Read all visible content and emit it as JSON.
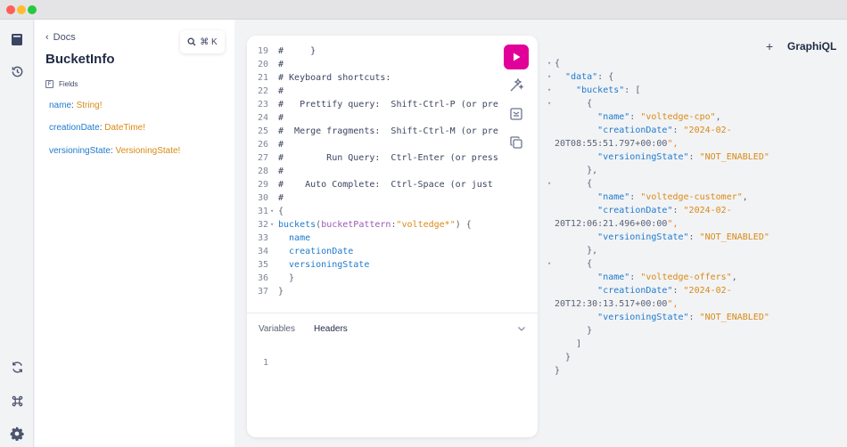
{
  "window": {
    "colors": {
      "red": "#fe5f57",
      "yellow": "#febc2e",
      "green": "#28c840"
    }
  },
  "sidebar_icons": [
    "docs-icon",
    "history-icon",
    "refetch-icon",
    "shortcuts-icon",
    "settings-icon"
  ],
  "docs": {
    "back_label": "Docs",
    "title": "BucketInfo",
    "fields_label": "Fields",
    "fields": [
      {
        "name": "name",
        "type": "String!"
      },
      {
        "name": "creationDate",
        "type": "DateTime!"
      },
      {
        "name": "versioningState",
        "type": "VersioningState!"
      }
    ]
  },
  "search": {
    "shortcut": "⌘ K"
  },
  "editor": {
    "lines": [
      {
        "n": "19",
        "t": "#     }"
      },
      {
        "n": "20",
        "t": "#"
      },
      {
        "n": "21",
        "t": "# Keyboard shortcuts:"
      },
      {
        "n": "22",
        "t": "#"
      },
      {
        "n": "23",
        "t": "#   Prettify query:  Shift-Ctrl-P (or pre"
      },
      {
        "n": "24",
        "t": "#"
      },
      {
        "n": "25",
        "t": "#  Merge fragments:  Shift-Ctrl-M (or pre"
      },
      {
        "n": "26",
        "t": "#"
      },
      {
        "n": "27",
        "t": "#        Run Query:  Ctrl-Enter (or press"
      },
      {
        "n": "28",
        "t": "#"
      },
      {
        "n": "29",
        "t": "#    Auto Complete:  Ctrl-Space (or just"
      },
      {
        "n": "30",
        "t": "#"
      },
      {
        "n": "31",
        "t": "{"
      },
      {
        "n": "32",
        "t": "buckets(bucketPattern:\"voltedge*\") {"
      },
      {
        "n": "33",
        "t": "  name"
      },
      {
        "n": "34",
        "t": "  creationDate"
      },
      {
        "n": "35",
        "t": "  versioningState"
      },
      {
        "n": "36",
        "t": "  }"
      },
      {
        "n": "37",
        "t": "}"
      }
    ],
    "query_parts": {
      "field": "buckets",
      "open_paren": "(",
      "arg": "bucketPattern",
      "colon": ":",
      "value": "\"voltedge*\"",
      "close": ") {"
    },
    "tabs": {
      "variables": "Variables",
      "headers": "Headers"
    },
    "variables_line": "1",
    "run_color": "#e10098"
  },
  "header": {
    "plus": "+",
    "brand": "GraphiQL"
  },
  "result": {
    "lines": [
      "{",
      "  \"data\": {",
      "    \"buckets\": [",
      "      {",
      "        \"name\": \"voltedge-cpo\",",
      "        \"creationDate\": \"2024-02-",
      "20T08:55:51.797+00:00\",",
      "        \"versioningState\": \"NOT_ENABLED\"",
      "      },",
      "      {",
      "        \"name\": \"voltedge-customer\",",
      "        \"creationDate\": \"2024-02-",
      "20T12:06:21.496+00:00\",",
      "        \"versioningState\": \"NOT_ENABLED\"",
      "      },",
      "      {",
      "        \"name\": \"voltedge-offers\",",
      "        \"creationDate\": \"2024-02-",
      "20T12:30:13.517+00:00\",",
      "        \"versioningState\": \"NOT_ENABLED\"",
      "      }",
      "    ]",
      "  }",
      "}"
    ]
  },
  "colors": {
    "accent": "#e10098",
    "field": "#1f7acd",
    "type": "#d98a16"
  }
}
